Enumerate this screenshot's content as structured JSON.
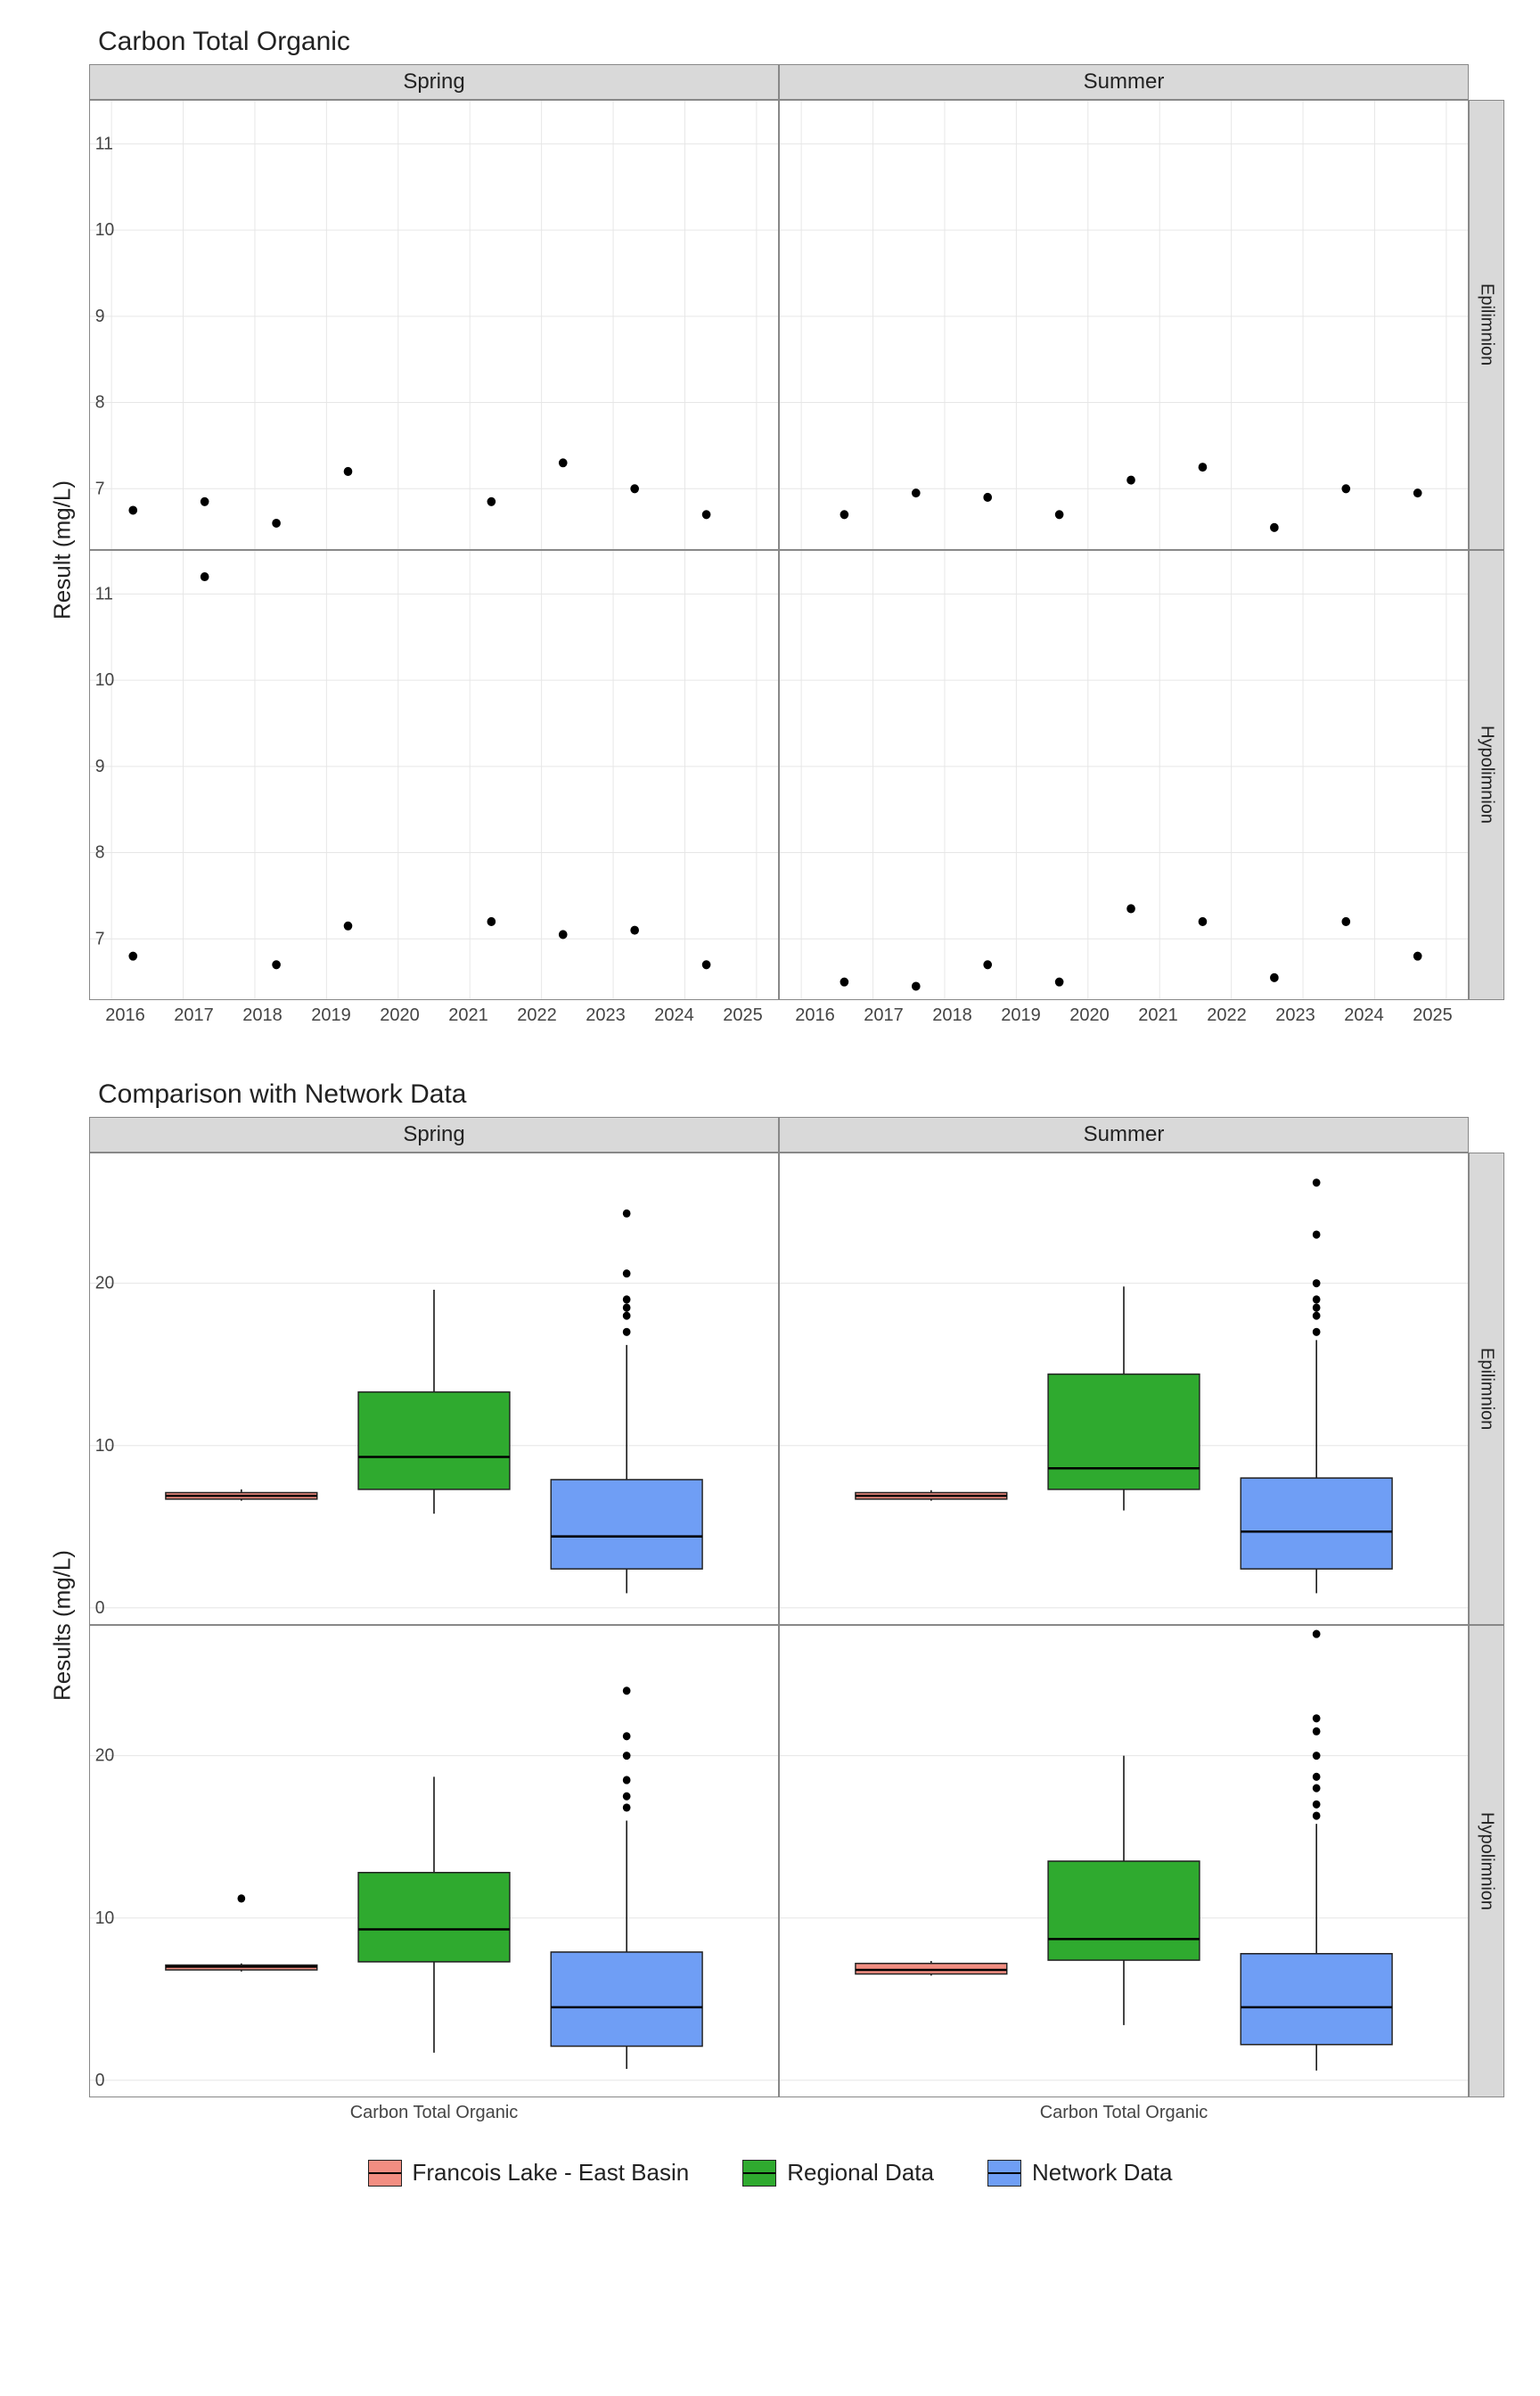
{
  "chart_data": [
    {
      "type": "scatter",
      "title": "Carbon Total Organic",
      "ylabel": "Result (mg/L)",
      "ylim": [
        6.3,
        11.5
      ],
      "xlim": [
        2015.7,
        2025.3
      ],
      "xticks": [
        2016,
        2017,
        2018,
        2019,
        2020,
        2021,
        2022,
        2023,
        2024,
        2025
      ],
      "yticks": [
        7,
        8,
        9,
        10,
        11
      ],
      "facets_col": [
        "Spring",
        "Summer"
      ],
      "facets_row": [
        "Epilimnion",
        "Hypolimnion"
      ],
      "series": [
        {
          "facet": "Spring/Epilimnion",
          "points": [
            [
              2016.3,
              6.75
            ],
            [
              2017.3,
              6.85
            ],
            [
              2018.3,
              6.6
            ],
            [
              2019.3,
              7.2
            ],
            [
              2021.3,
              6.85
            ],
            [
              2022.3,
              7.3
            ],
            [
              2023.3,
              7.0
            ],
            [
              2024.3,
              6.7
            ]
          ]
        },
        {
          "facet": "Summer/Epilimnion",
          "points": [
            [
              2016.6,
              6.7
            ],
            [
              2017.6,
              6.95
            ],
            [
              2018.6,
              6.9
            ],
            [
              2019.6,
              6.7
            ],
            [
              2020.6,
              7.1
            ],
            [
              2021.6,
              7.25
            ],
            [
              2022.6,
              6.55
            ],
            [
              2023.6,
              7.0
            ],
            [
              2024.6,
              6.95
            ]
          ]
        },
        {
          "facet": "Spring/Hypolimnion",
          "points": [
            [
              2016.3,
              6.8
            ],
            [
              2017.3,
              11.2
            ],
            [
              2018.3,
              6.7
            ],
            [
              2019.3,
              7.15
            ],
            [
              2021.3,
              7.2
            ],
            [
              2022.3,
              7.05
            ],
            [
              2023.3,
              7.1
            ],
            [
              2024.3,
              6.7
            ]
          ]
        },
        {
          "facet": "Summer/Hypolimnion",
          "points": [
            [
              2016.6,
              6.5
            ],
            [
              2017.6,
              6.45
            ],
            [
              2018.6,
              6.7
            ],
            [
              2019.6,
              6.5
            ],
            [
              2020.6,
              7.35
            ],
            [
              2021.6,
              7.2
            ],
            [
              2022.6,
              6.55
            ],
            [
              2023.6,
              7.2
            ],
            [
              2024.6,
              6.8
            ]
          ]
        }
      ]
    },
    {
      "type": "box",
      "title": "Comparison with Network Data",
      "ylabel": "Results (mg/L)",
      "ylim": [
        -1,
        28
      ],
      "yticks": [
        0,
        10,
        20
      ],
      "facets_col": [
        "Spring",
        "Summer"
      ],
      "facets_row": [
        "Epilimnion",
        "Hypolimnion"
      ],
      "xcat_label": "Carbon Total Organic",
      "legend": [
        {
          "name": "Francois Lake - East Basin",
          "color": "#f28e82"
        },
        {
          "name": "Regional Data",
          "color": "#2faa2f"
        },
        {
          "name": "Network Data",
          "color": "#6f9ef5"
        }
      ],
      "boxes": {
        "Spring/Epilimnion": [
          {
            "g": "Francois",
            "min": 6.6,
            "q1": 6.7,
            "med": 6.9,
            "q3": 7.1,
            "max": 7.3,
            "out": []
          },
          {
            "g": "Regional",
            "min": 5.8,
            "q1": 7.3,
            "med": 9.3,
            "q3": 13.3,
            "max": 19.6,
            "out": []
          },
          {
            "g": "Network",
            "min": 0.9,
            "q1": 2.4,
            "med": 4.4,
            "q3": 7.9,
            "max": 16.2,
            "out": [
              17,
              18,
              18.5,
              19,
              20.6,
              24.3
            ]
          }
        ],
        "Summer/Epilimnion": [
          {
            "g": "Francois",
            "min": 6.6,
            "q1": 6.7,
            "med": 6.9,
            "q3": 7.1,
            "max": 7.25,
            "out": []
          },
          {
            "g": "Regional",
            "min": 6.0,
            "q1": 7.3,
            "med": 8.6,
            "q3": 14.4,
            "max": 19.8,
            "out": []
          },
          {
            "g": "Network",
            "min": 0.9,
            "q1": 2.4,
            "med": 4.7,
            "q3": 8.0,
            "max": 16.5,
            "out": [
              17,
              18,
              18.5,
              19,
              20,
              23,
              26.2
            ]
          }
        ],
        "Spring/Hypolimnion": [
          {
            "g": "Francois",
            "min": 6.7,
            "q1": 6.8,
            "med": 7.0,
            "q3": 7.1,
            "max": 7.2,
            "out": [
              11.2
            ]
          },
          {
            "g": "Regional",
            "min": 1.7,
            "q1": 7.3,
            "med": 9.3,
            "q3": 12.8,
            "max": 18.7,
            "out": []
          },
          {
            "g": "Network",
            "min": 0.7,
            "q1": 2.1,
            "med": 4.5,
            "q3": 7.9,
            "max": 16.0,
            "out": [
              16.8,
              17.5,
              18.5,
              20,
              21.2,
              24
            ]
          }
        ],
        "Summer/Hypolimnion": [
          {
            "g": "Francois",
            "min": 6.45,
            "q1": 6.55,
            "med": 6.8,
            "q3": 7.2,
            "max": 7.35,
            "out": []
          },
          {
            "g": "Regional",
            "min": 3.4,
            "q1": 7.4,
            "med": 8.7,
            "q3": 13.5,
            "max": 20,
            "out": []
          },
          {
            "g": "Network",
            "min": 0.6,
            "q1": 2.2,
            "med": 4.5,
            "q3": 7.8,
            "max": 15.8,
            "out": [
              16.3,
              17,
              18,
              18.7,
              20,
              21.5,
              22.3,
              27.5
            ]
          }
        ]
      }
    }
  ]
}
